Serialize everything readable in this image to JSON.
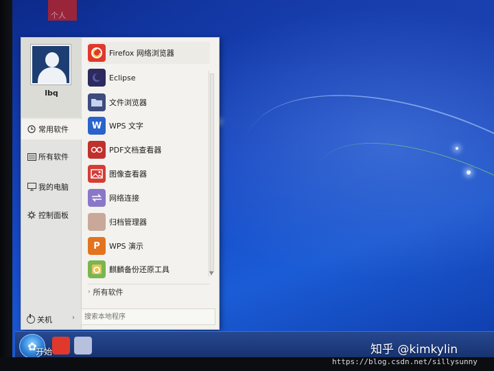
{
  "desktop": {
    "top_item_label": "个人"
  },
  "user": {
    "name": "lbq"
  },
  "categories": [
    {
      "label": "常用软件",
      "icon": "clock-icon"
    },
    {
      "label": "所有软件",
      "icon": "grid-icon"
    },
    {
      "label": "我的电脑",
      "icon": "monitor-icon"
    },
    {
      "label": "控制面板",
      "icon": "gear-icon"
    }
  ],
  "apps": [
    {
      "label": "Firefox 网络浏览器",
      "icon": "firefox-icon",
      "color": "#e0392b"
    },
    {
      "label": "Eclipse",
      "icon": "eclipse-icon",
      "color": "#2c2a5e"
    },
    {
      "label": "文件浏览器",
      "icon": "folder-icon",
      "color": "#3d4b7d"
    },
    {
      "label": "WPS 文字",
      "icon": "wps-writer-icon",
      "color": "#2a63c9"
    },
    {
      "label": "PDF文档查看器",
      "icon": "pdf-viewer-icon",
      "color": "#c0312d"
    },
    {
      "label": "图像查看器",
      "icon": "image-viewer-icon",
      "color": "#d63b36"
    },
    {
      "label": "网络连接",
      "icon": "network-icon",
      "color": "#8a77c9"
    },
    {
      "label": "归档管理器",
      "icon": "archive-icon",
      "color": "#c9a89a"
    },
    {
      "label": "WPS 演示",
      "icon": "wps-presentation-icon",
      "color": "#e3731f"
    },
    {
      "label": "麒麟备份还原工具",
      "icon": "backup-icon",
      "color": "#7ab650"
    }
  ],
  "all_software_link": "所有软件",
  "power": {
    "label": "关机"
  },
  "search": {
    "placeholder": "搜索本地程序"
  },
  "taskbar": {
    "start_label": "开始"
  },
  "watermark": {
    "text": "知乎 @kimkylin",
    "url": "https://blog.csdn.net/sillysunny"
  }
}
